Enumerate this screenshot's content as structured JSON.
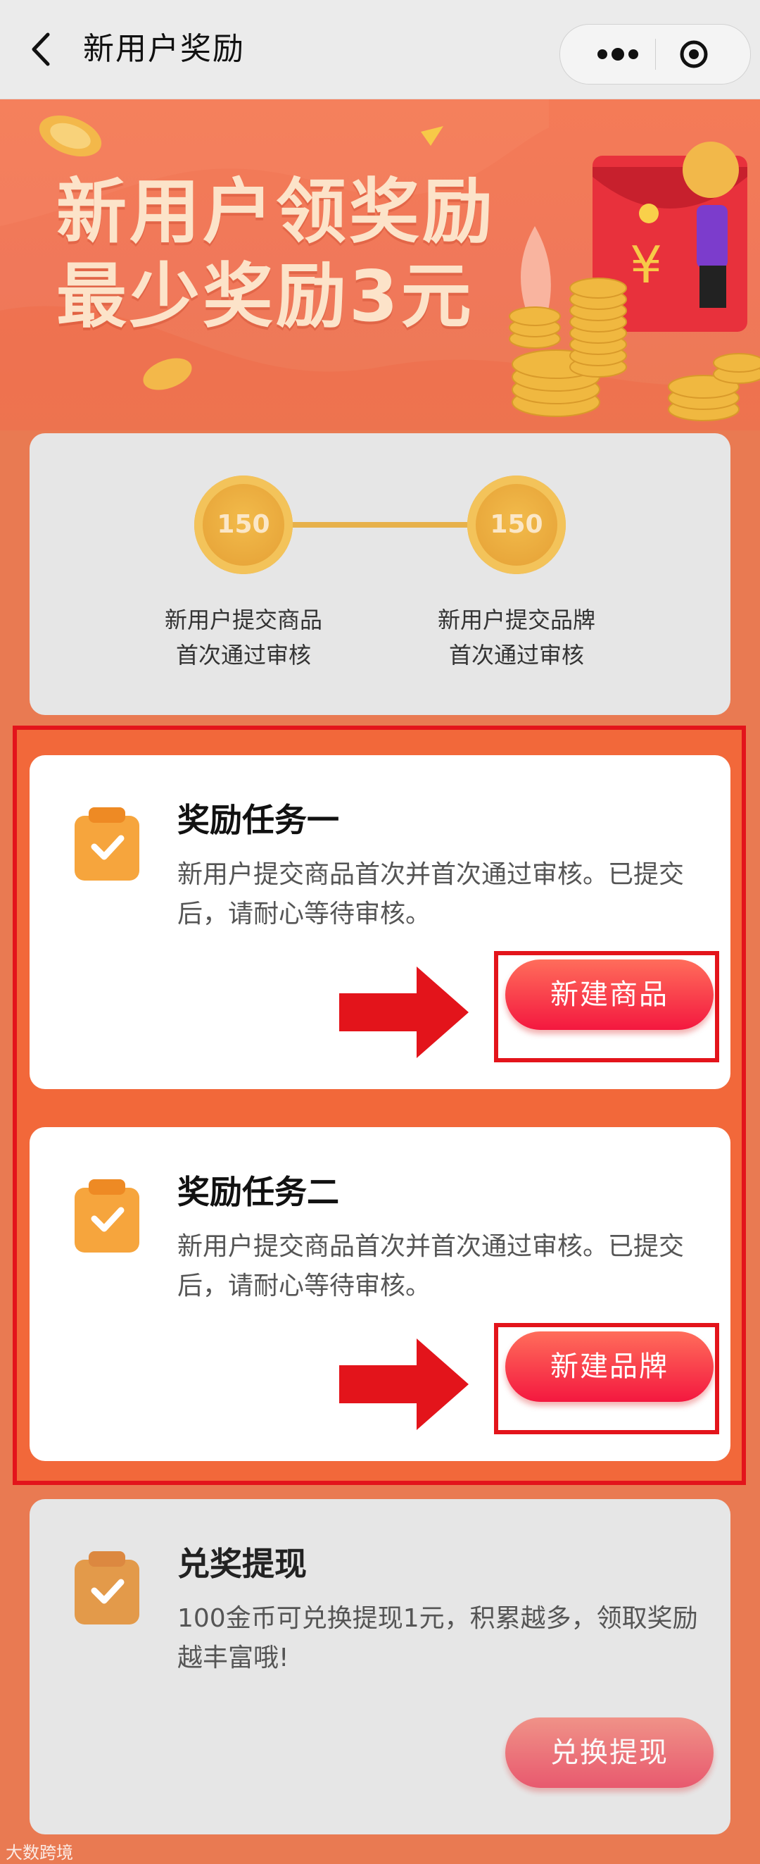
{
  "header": {
    "title": "新用户奖励"
  },
  "banner": {
    "line1": "新用户领奖励",
    "line2": "最少奖励3元"
  },
  "progress": {
    "steps": [
      {
        "coin": "150",
        "label_line1": "新用户提交商品",
        "label_line2": "首次通过审核"
      },
      {
        "coin": "150",
        "label_line1": "新用户提交品牌",
        "label_line2": "首次通过审核"
      }
    ]
  },
  "tasks": [
    {
      "title": "奖励任务一",
      "desc": "新用户提交商品首次并首次通过审核。已提交后，请耐心等待审核。",
      "button": "新建商品"
    },
    {
      "title": "奖励任务二",
      "desc": "新用户提交商品首次并首次通过审核。已提交后，请耐心等待审核。",
      "button": "新建品牌"
    },
    {
      "title": "兑奖提现",
      "desc": "100金币可兑换提现1元，积累越多，领取奖励越丰富哦!",
      "button": "兑换提现"
    }
  ],
  "watermark": "大数跨境",
  "colors": {
    "accent": "#f4183f",
    "highlight": "#e3141b",
    "banner": "#f47b57",
    "coin": "#e8a63a"
  },
  "icons": [
    "back-icon",
    "more-dots-icon",
    "target-icon",
    "clipboard-check-icon",
    "red-arrow-icon"
  ]
}
